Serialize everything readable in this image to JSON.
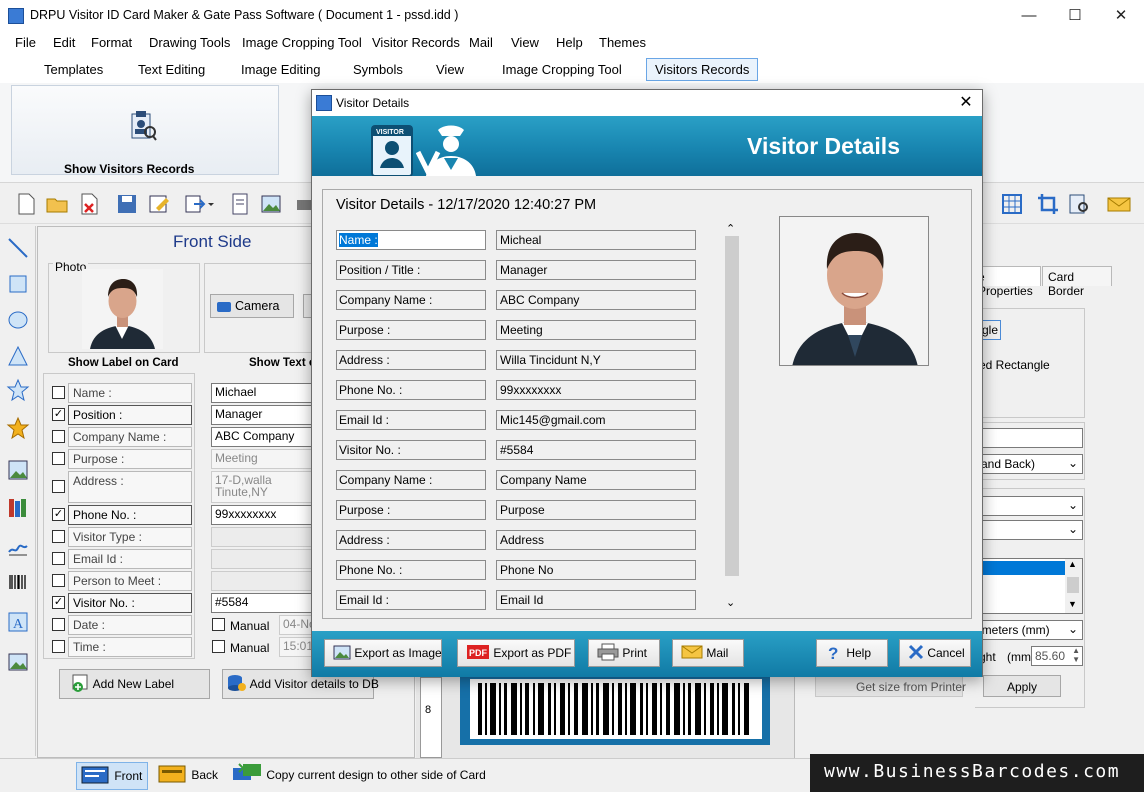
{
  "window": {
    "title": "DRPU Visitor ID Card Maker & Gate Pass Software ( Document 1 - pssd.idd )"
  },
  "menu": [
    "File",
    "Edit",
    "Format",
    "Drawing Tools",
    "Image Cropping Tool",
    "Visitor Records",
    "Mail",
    "View",
    "Help",
    "Themes"
  ],
  "ribbon_tabs": [
    "Templates",
    "Text Editing",
    "Image Editing",
    "Symbols",
    "View",
    "Image Cropping Tool",
    "Visitors Records"
  ],
  "ribbon": {
    "show_records": "Show Visitors Records"
  },
  "left_panel": {
    "title": "Front Side",
    "photo_label": "Photo",
    "camera_button": "Camera",
    "show_label_header": "Show Label on Card",
    "show_text_header": "Show Text o",
    "rows": [
      {
        "label": "Name :",
        "checked": false,
        "value": "Michael"
      },
      {
        "label": "Position      :",
        "checked": true,
        "value": "Manager"
      },
      {
        "label": "Company Name :",
        "checked": false,
        "value": "ABC Company"
      },
      {
        "label": "Purpose :",
        "checked": false,
        "value": "Meeting"
      },
      {
        "label": "Address :",
        "checked": false,
        "value": "17-D,walla\nTinute,NY"
      },
      {
        "label": "Phone No. :",
        "checked": true,
        "value": "99xxxxxxxx"
      },
      {
        "label": "Visitor Type :",
        "checked": false,
        "value": ""
      },
      {
        "label": "Email Id :",
        "checked": false,
        "value": ""
      },
      {
        "label": "Person to Meet :",
        "checked": false,
        "value": ""
      },
      {
        "label": "Visitor No. :",
        "checked": true,
        "value": "#5584"
      },
      {
        "label": "Date :",
        "checked": false,
        "value": "04-No"
      },
      {
        "label": "Time :",
        "checked": false,
        "value": "15:01"
      }
    ],
    "manual_label": "Manual",
    "add_label_button": "Add New Label",
    "add_visitor_button": "Add Visitor details to DB"
  },
  "right_panel": {
    "tabs": [
      "e Properties",
      "Card Border"
    ],
    "shape_option": "gle",
    "rounded_option": "ed Rectangle",
    "side_select": "and Back)",
    "unit_select": "imeters (mm)",
    "height_label": "ght",
    "height_unit": "(mm)",
    "height_value": "85.60",
    "printer_button": "Get size from Printer",
    "apply_button": "Apply"
  },
  "ruler": {
    "mark": "8"
  },
  "bottom": {
    "front": "Front",
    "back": "Back",
    "copy": "Copy current design to other side of Card"
  },
  "watermark": "www.BusinessBarcodes.com",
  "dialog": {
    "window_title": "Visitor Details",
    "banner_title": "Visitor Details",
    "banner_badge": "VISITOR",
    "header": "Visitor Details - 12/17/2020 12:40:27 PM",
    "rows": [
      {
        "label": "Name :",
        "value": "Micheal"
      },
      {
        "label": "Position / Title :",
        "value": "Manager"
      },
      {
        "label": "Company Name :",
        "value": "ABC Company"
      },
      {
        "label": "Purpose :",
        "value": "Meeting"
      },
      {
        "label": "Address :",
        "value": "Willa Tincidunt N,Y"
      },
      {
        "label": "Phone No. :",
        "value": "99xxxxxxxx"
      },
      {
        "label": "Email Id :",
        "value": "Mic145@gmail.com"
      },
      {
        "label": "Visitor No. :",
        "value": "#5584"
      },
      {
        "label": "Company Name :",
        "value": "Company Name"
      },
      {
        "label": "Purpose :",
        "value": "Purpose"
      },
      {
        "label": "Address :",
        "value": "Address"
      },
      {
        "label": "Phone No. :",
        "value": "Phone No"
      },
      {
        "label": "Email Id :",
        "value": "Email Id"
      }
    ],
    "buttons": {
      "export_image": "Export as Image",
      "export_pdf": "Export as PDF",
      "pdf_badge": "PDF",
      "print": "Print",
      "mail": "Mail",
      "help": "Help",
      "cancel": "Cancel"
    }
  }
}
